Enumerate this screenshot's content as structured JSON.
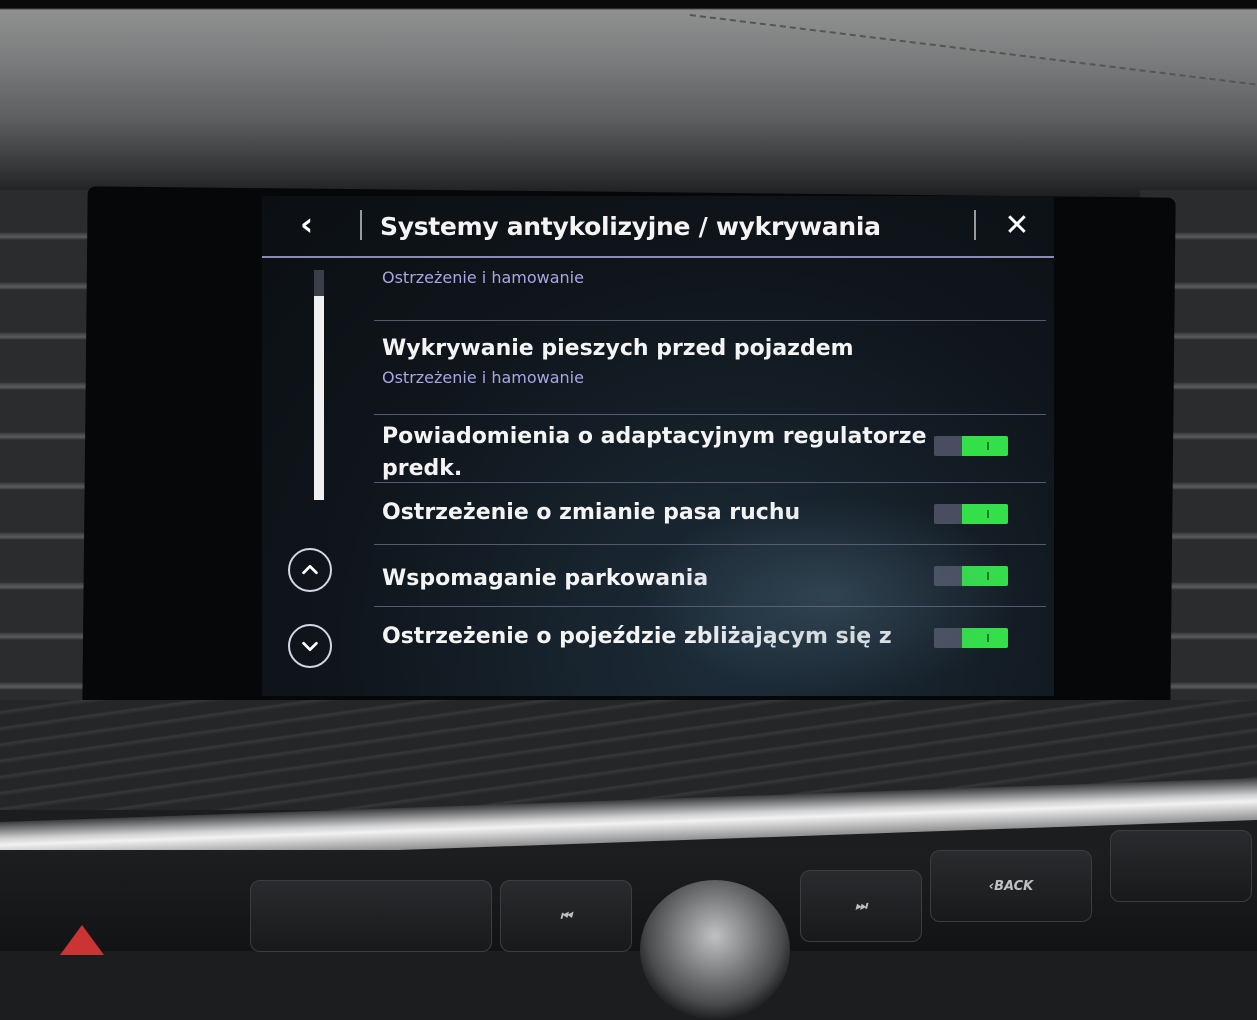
{
  "header": {
    "back_icon": "chevron-left-icon",
    "title": "Systemy antykolizyjne / wykrywania",
    "close_icon": "close-icon"
  },
  "list": {
    "items": [
      {
        "label": "",
        "sublabel": "Ostrzeżenie i hamowanie"
      },
      {
        "label": "Wykrywanie pieszych przed pojazdem",
        "sublabel": "Ostrzeżenie i hamowanie"
      },
      {
        "label": "Powiadomienia o adaptacyjnym regulatorze",
        "label_line2": "predk.",
        "toggle": "on"
      },
      {
        "label": "Ostrzeżenie o zmianie pasa ruchu",
        "toggle": "on"
      },
      {
        "label": "Wspomaganie parkowania",
        "toggle": "on"
      },
      {
        "label": "Ostrzeżenie o pojeździe zbliżającym się z",
        "toggle": "on"
      }
    ]
  },
  "scroll": {
    "up_icon": "chevron-up-icon",
    "down_icon": "chevron-down-icon"
  },
  "car_controls": {
    "back_label": "‹BACK",
    "next_icon": "skip-forward-icon",
    "prev_icon": "skip-back-icon"
  },
  "colors": {
    "toggle_on": "#34e04a",
    "subtitle": "#a9a6e6",
    "header_rule": "#8e8ab8"
  }
}
